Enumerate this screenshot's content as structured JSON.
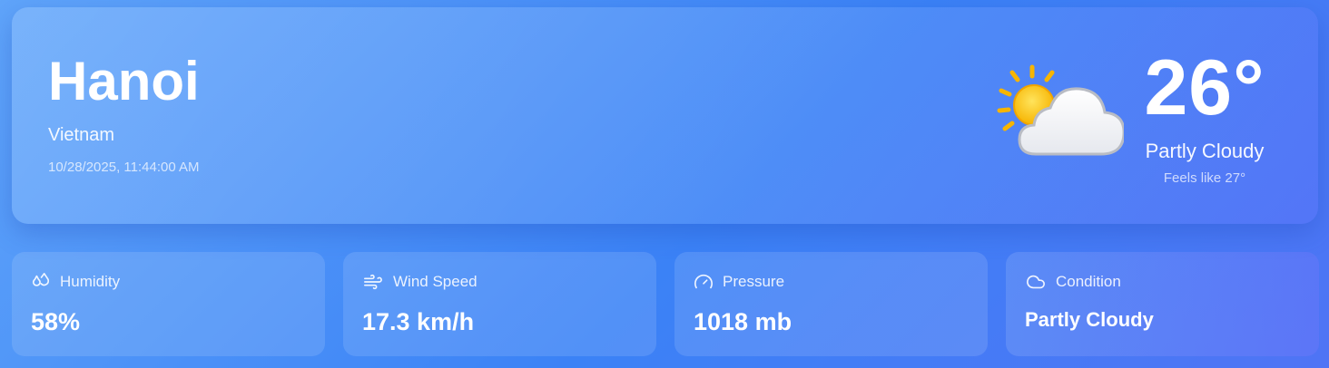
{
  "location": {
    "city": "Hanoi",
    "country": "Vietnam",
    "datetime": "10/28/2025, 11:44:00 AM"
  },
  "current": {
    "temperature": "26°",
    "condition": "Partly Cloudy",
    "feels_like": "Feels like 27°",
    "icon": "partly-cloudy-icon"
  },
  "stats": [
    {
      "label": "Humidity",
      "value": "58%",
      "icon": "droplets-icon"
    },
    {
      "label": "Wind Speed",
      "value": "17.3 km/h",
      "icon": "wind-icon"
    },
    {
      "label": "Pressure",
      "value": "1018 mb",
      "icon": "gauge-icon"
    },
    {
      "label": "Condition",
      "value": "Partly Cloudy",
      "icon": "cloud-icon"
    }
  ]
}
